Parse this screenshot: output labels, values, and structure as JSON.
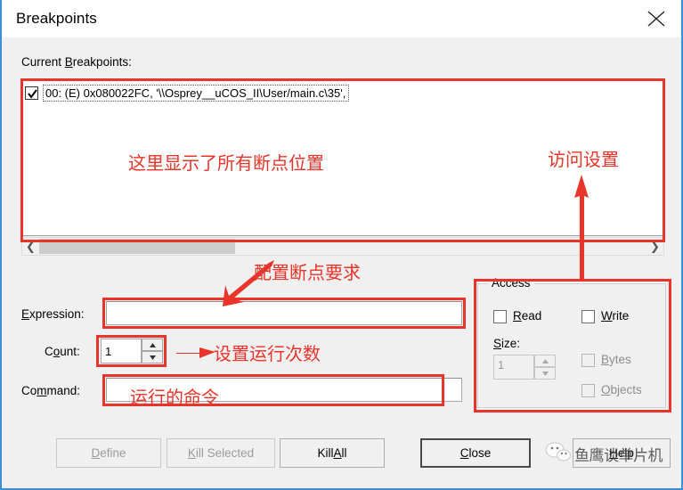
{
  "window": {
    "title": "Breakpoints",
    "close_icon": "close-icon"
  },
  "list": {
    "label": "Current Breakpoints:",
    "label_prefix": "Current ",
    "label_accel": "B",
    "label_suffix": "reakpoints:",
    "items": [
      {
        "checked": true,
        "text": "00: (E) 0x080022FC,  '\\\\Osprey__uCOS_II\\User/main.c\\35',"
      }
    ],
    "scroll_left_icon": "chevron-left-icon",
    "scroll_right_icon": "chevron-right-icon"
  },
  "fields": {
    "expression": {
      "label_accel": "E",
      "label_prefix": "",
      "label_suffix": "xpression:",
      "value": "",
      "placeholder": ""
    },
    "count": {
      "label_pre": "C",
      "label_accel": "o",
      "label_post": "unt:",
      "value": "1",
      "spin_up_icon": "spin-up-icon",
      "spin_down_icon": "spin-down-icon"
    },
    "command": {
      "label_pre": "Co",
      "label_accel": "m",
      "label_post": "mand:",
      "value": "",
      "placeholder": ""
    }
  },
  "access": {
    "legend": "Access",
    "read": {
      "label_accel": "R",
      "label_suffix": "ead",
      "checked": false,
      "enabled": true
    },
    "write": {
      "label_accel": "W",
      "label_suffix": "rite",
      "checked": false,
      "enabled": true
    },
    "size": {
      "label_accel": "S",
      "label_suffix": "ize:",
      "value": "1",
      "enabled": false
    },
    "bytes": {
      "label_accel": "B",
      "label_suffix": "ytes",
      "checked": false,
      "enabled": false
    },
    "objects": {
      "label_accel": "O",
      "label_suffix": "bjects",
      "checked": false,
      "enabled": false
    }
  },
  "buttons": {
    "define": {
      "pre": "",
      "accel": "D",
      "post": "efine",
      "enabled": false
    },
    "kill_selected": {
      "pre": "",
      "accel": "K",
      "post": "ill Selected",
      "enabled": false
    },
    "kill_all": {
      "pre": "Kill ",
      "accel": "A",
      "post": "ll",
      "enabled": true
    },
    "close": {
      "pre": "",
      "accel": "C",
      "post": "lose",
      "enabled": true,
      "is_default": true
    },
    "help": {
      "pre": "",
      "accel": "H",
      "post": "elp",
      "enabled": true
    }
  },
  "annotations": {
    "list_area": "这里显示了所有断点位置",
    "access_area": "访问设置",
    "expression_area": "配置断点要求",
    "count_area": "设置运行次数",
    "command_area": "运行的命令"
  },
  "watermark": {
    "text": "鱼鹰谈单片机",
    "logo_icon": "wechat-logo-icon"
  },
  "colors": {
    "annotation_red": "#e8342a",
    "dialog_bg": "#f0f0f0",
    "window_border": "#3b8fd4"
  }
}
